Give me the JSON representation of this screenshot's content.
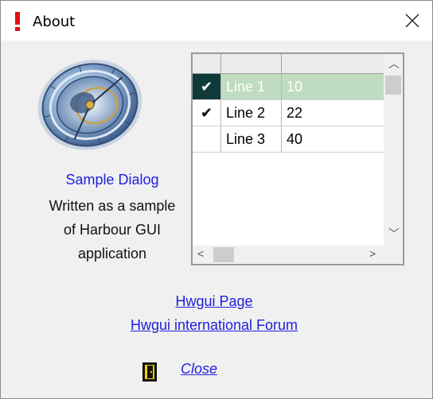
{
  "window": {
    "title": "About"
  },
  "icons": {
    "title": "exclamation-icon",
    "close": "close-icon",
    "logo": "astronomical-clock-icon",
    "exit": "exit-door-icon"
  },
  "left_panel": {
    "title": "Sample Dialog",
    "lines": [
      "Written as a sample",
      "of Harbour GUI",
      "application"
    ]
  },
  "grid": {
    "rows": [
      {
        "check": "✔",
        "col1": "Line 1",
        "col2": "10",
        "selected": true
      },
      {
        "check": "✔",
        "col1": "Line 2",
        "col2": "22",
        "selected": false
      },
      {
        "check": "",
        "col1": "Line 3",
        "col2": "40",
        "selected": false
      }
    ]
  },
  "links": {
    "page": "Hwgui Page",
    "forum": "Hwgui international Forum"
  },
  "close_button": {
    "label": "Close"
  },
  "colors": {
    "link": "#2020e0",
    "selected_row": "#c0dcc0",
    "selected_marker": "#0e3a3a"
  }
}
